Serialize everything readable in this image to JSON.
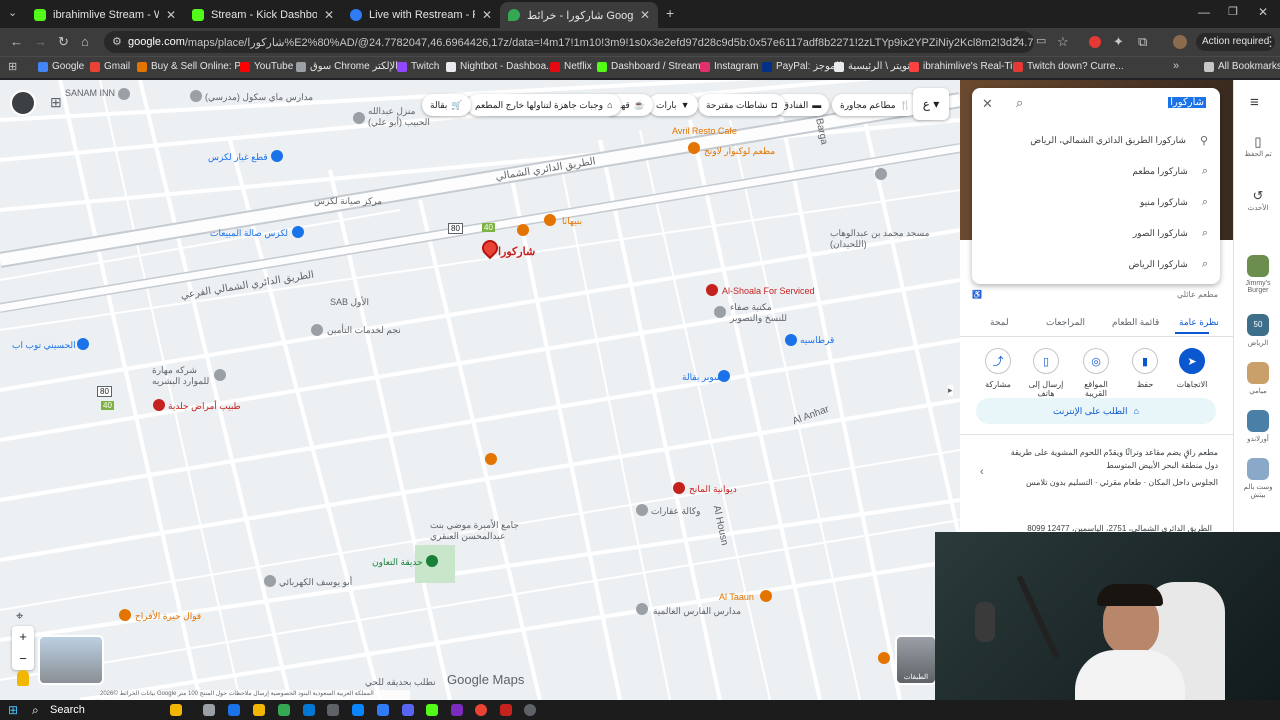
{
  "tabs": [
    {
      "title": "ibrahimlive Stream - Watch Live",
      "color": "#53fc18",
      "active": false
    },
    {
      "title": "Stream - Kick Dashboard",
      "color": "#53fc18",
      "active": false
    },
    {
      "title": "Live with Restream - Restream",
      "color": "#2f7cf6",
      "active": false
    },
    {
      "title": "شاركورا - خرائط Google",
      "color": "#34a853",
      "active": true
    }
  ],
  "browser": {
    "url_domain": "google.com",
    "url_path": "/maps/place/شاركورا%E2%80%AD/@24.7782047,46.6964426,17z/data=!4m17!1m10!3m9!1s0x3e2efd97d28c9d5b:0x57e6117adf8b2271!2zLTYp9ix2YPZiNiy2Kcl8m2!3d24.7800652!4d46.6940165!10e5!...",
    "action_required": "Action required",
    "bookmarks": [
      {
        "label": "Google",
        "color": "#4285f4"
      },
      {
        "label": "Gmail",
        "color": "#ea4335"
      },
      {
        "label": "Buy & Sell Online: P...",
        "color": "#e37400"
      },
      {
        "label": "YouTube",
        "color": "#ff0000"
      },
      {
        "label": "سوق Chrome الإلكتر...",
        "color": "#9aa0a6"
      },
      {
        "label": "Twitch",
        "color": "#9146ff"
      },
      {
        "label": "Nightbot - Dashboa...",
        "color": "#e8eaed"
      },
      {
        "label": "Netflix",
        "color": "#e50914"
      },
      {
        "label": "Dashboard / Stream...",
        "color": "#53fc18"
      },
      {
        "label": "Instagram",
        "color": "#e1306c"
      },
      {
        "label": "PayPal: الموجز",
        "color": "#003087"
      },
      {
        "label": "تويتر \\ الرئيسية",
        "color": "#e8eaed"
      },
      {
        "label": "ibrahimlive's Real-Ti...",
        "color": "#ff4040"
      },
      {
        "label": "Twitch down? Curre...",
        "color": "#e53935"
      }
    ],
    "all_bookmarks": "All Bookmarks"
  },
  "map": {
    "chips": [
      "مطاعم مجاورة",
      "الفنادق",
      "نشاطات مقترحة",
      "بارات",
      "قهوة",
      "وجبات جاهزة لتناولها خارج المطعم",
      "بقالة"
    ],
    "pin_label": "شاركورا",
    "labels": [
      {
        "text": "SANAM INN",
        "color": "#5f6368"
      },
      {
        "text": "مدارس ماي سكول (مدرسي)",
        "color": "#5f6368"
      },
      {
        "text": "منزل عبدالله الحبيب (أبو علي)",
        "color": "#5f6368"
      },
      {
        "text": "قطع غيار لكزس",
        "color": "#1a73e8"
      },
      {
        "text": "مركز صيانة لكزس",
        "color": "#5f6368"
      },
      {
        "text": "لكزس صالة المبيعات",
        "color": "#1a73e8"
      },
      {
        "text": "Avril Resto Cafe",
        "color": "#e37400"
      },
      {
        "text": "مطعم لوكنوار لاونج",
        "color": "#e37400"
      },
      {
        "text": "بنيهانا",
        "color": "#e37400"
      },
      {
        "text": "Al-Shoala For Serviced",
        "color": "#c5221f"
      },
      {
        "text": "مكتبة صفاء للنسخ والتصوير",
        "color": "#5f6368"
      },
      {
        "text": "قرطاسيه",
        "color": "#1a73e8"
      },
      {
        "text": "SAB الأول",
        "color": "#5f6368"
      },
      {
        "text": "نجم لخدمات التأمين",
        "color": "#5f6368"
      },
      {
        "text": "الحسيني توب اب",
        "color": "#1a73e8"
      },
      {
        "text": "شركه مهارة للموارد البشريه",
        "color": "#5f6368"
      },
      {
        "text": "طبيب أمراض جلدية",
        "color": "#c5221f"
      },
      {
        "text": "سوبر بقالة",
        "color": "#1a73e8"
      },
      {
        "text": "ديوانية المانح",
        "color": "#c5221f"
      },
      {
        "text": "وكالة عقارات",
        "color": "#5f6368"
      },
      {
        "text": "جامع الأميرة موضي بنت عبدالمحسن العنقري",
        "color": "#5f6368"
      },
      {
        "text": "حديقة التعاون",
        "color": "#188038"
      },
      {
        "text": "أبو يوسف الكهربائي",
        "color": "#5f6368"
      },
      {
        "text": "فوال حيرة الأفراح",
        "color": "#e37400"
      },
      {
        "text": "Al Taaun",
        "color": "#e37400"
      },
      {
        "text": "مدارس الفارس العالمية",
        "color": "#5f6368"
      },
      {
        "text": "مسجد محمد بن عبدالوهاب (اللحيدان)",
        "color": "#5f6368"
      },
      {
        "text": "نطلب بحديقه للحي",
        "color": "#5f6368"
      },
      {
        "text": "Al Anhar",
        "color": "#5f6368"
      },
      {
        "text": "Al Housn",
        "color": "#5f6368"
      },
      {
        "text": "Barga",
        "color": "#5f6368"
      },
      {
        "text": "الطريق الدائري الشمالي",
        "color": "#5f6368"
      },
      {
        "text": "الطريق الدائري الشمالي الفرعي",
        "color": "#5f6368"
      }
    ],
    "road_shields": [
      "80",
      "40",
      "80",
      "40"
    ],
    "google_maps": "Google Maps",
    "footer": "بيانات الخرائط ©2026 Google   المملكة العربية السعودية   البنود   الخصوصية   إرسال ملاحظات حول المنتج   100 متر",
    "layers_label": "الطبقات"
  },
  "search": {
    "query": "شاركورا",
    "suggestions": [
      {
        "text": "شاركورا الطريق الدائري الشمالي، الرياض",
        "icon": "pin-icon"
      },
      {
        "text": "شاركورا مطعم",
        "icon": "search-icon"
      },
      {
        "text": "شاركورا منيو",
        "icon": "search-icon"
      },
      {
        "text": "شاركورا الصور",
        "icon": "search-icon"
      },
      {
        "text": "شاركورا الرياض",
        "icon": "search-icon"
      }
    ]
  },
  "place": {
    "category": "مطعم عائلي",
    "tabs": [
      "نظرة عامة",
      "قائمة الطعام",
      "المراجعات",
      "لمحة"
    ],
    "actions": [
      "الاتجاهات",
      "حفظ",
      "المواقع القريبة",
      "إرسال إلى هاتف",
      "مشاركة"
    ],
    "order_online": "الطلب على الإنترنت",
    "description": "مطعم راقٍ يضم مقاعد وتراثًا ويقدّم اللحوم المشوية على طريقة دول منطقة البحر الأبيض المتوسط",
    "features": "الجلوس داخل المكان · طعام مقرئي · التسليم بدون تلامس",
    "address_partial": "8099 الطريق الدائري الشمالي، 2751، الياسمين، 12477"
  },
  "rail": {
    "saved": "تم الحفظ",
    "recent": "الأحدث",
    "items": [
      {
        "label": "Jimmy's Burger",
        "color": "#6b8e4e"
      },
      {
        "label": "الرياض",
        "color": "#3d6f8a",
        "badge": "50"
      },
      {
        "label": "ميامي",
        "color": "#c9a06a"
      },
      {
        "label": "أورلاندو",
        "color": "#4a7fa8"
      },
      {
        "label": "وست بالم بيتش",
        "color": "#8aa9c9"
      }
    ]
  },
  "taskbar": {
    "search": "Search"
  }
}
